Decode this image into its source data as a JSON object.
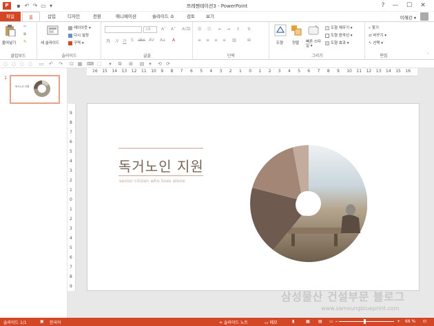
{
  "app": {
    "icon_letter": "P",
    "window_title": "프레젠테이션3 - PowerPoint",
    "window_controls": [
      "?",
      "—",
      "☐",
      "✕"
    ],
    "user_name": "이해강 ▾"
  },
  "tabs": [
    {
      "label": "파일"
    },
    {
      "label": "홈"
    },
    {
      "label": "삽입"
    },
    {
      "label": "디자인"
    },
    {
      "label": "전환"
    },
    {
      "label": "애니메이션"
    },
    {
      "label": "슬라이드 쇼"
    },
    {
      "label": "검토"
    },
    {
      "label": "보기"
    }
  ],
  "ribbon": {
    "clipboard": {
      "paste": "붙여넣기",
      "label": "클립보드"
    },
    "slides": {
      "new_slide": "새 슬라이드",
      "layout": "레이아웃 ▾",
      "reset": "다시 설정",
      "section": "구역 ▾",
      "label": "슬라이드"
    },
    "font": {
      "size": "18",
      "label": "글꼴"
    },
    "paragraph": {
      "label": "단락"
    },
    "drawing": {
      "shapes": "도형",
      "arrange": "정렬",
      "quick_styles": "빠른 스타일 ▾",
      "fill": "도형 채우기 ▾",
      "outline": "도형 윤곽선 ▾",
      "effects": "도형 효과 ▾",
      "label": "그리기"
    },
    "editing": {
      "find": "찾기",
      "replace": "바꾸기 ▾",
      "select": "선택 ▾",
      "label": "편집"
    }
  },
  "thumbnail": {
    "number": "1",
    "title": "독거노인 지원"
  },
  "ruler": {
    "h_ticks": [
      "16",
      "15",
      "14",
      "13",
      "12",
      "11",
      "10",
      "9",
      "8",
      "7",
      "6",
      "5",
      "4",
      "3",
      "2",
      "1",
      "0",
      "1",
      "2",
      "3",
      "4",
      "5",
      "6",
      "7",
      "8",
      "9",
      "10",
      "11",
      "12",
      "13",
      "14",
      "15",
      "16"
    ],
    "v_ticks": [
      "9",
      "8",
      "7",
      "6",
      "5",
      "4",
      "3",
      "2",
      "1",
      "0",
      "1",
      "2",
      "3",
      "4",
      "5",
      "6",
      "7",
      "8",
      "9"
    ]
  },
  "slide": {
    "title": "독거노인 지원",
    "subtitle": "senior citizen who lives alone",
    "donut_colors": [
      "#6f5a4f",
      "#a48676",
      "#c3ab9d"
    ]
  },
  "watermark": {
    "text": "삼성물산 건설부문 블로그",
    "url": "www.samsungblueprint.com"
  },
  "status": {
    "slide_of": "슬라이드 1/1",
    "language": "한국어",
    "notes": "슬라이드 노트",
    "comments": "메모",
    "zoom": "66 %",
    "zoom_level": 0.66
  }
}
